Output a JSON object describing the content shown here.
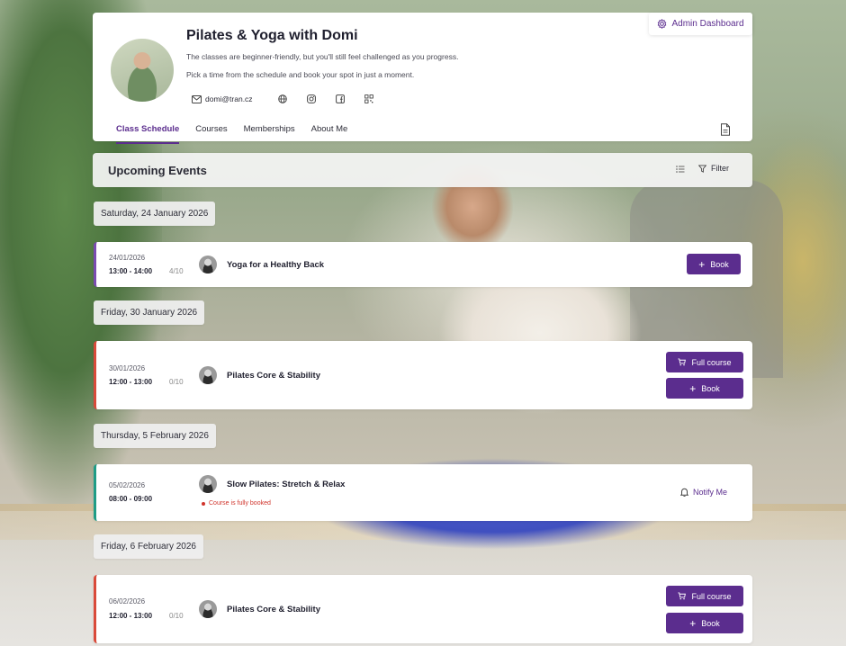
{
  "profile": {
    "title": "Pilates & Yoga with Domi",
    "desc_line1": "The classes are beginner-friendly, but you'll still feel challenged as you progress.",
    "desc_line2": "Pick a time from the schedule and book your spot in just a moment.",
    "email": "domi@tran.cz",
    "contact_icons": [
      "mail-icon",
      "globe-icon",
      "instagram-icon",
      "facebook-icon",
      "qr-icon"
    ]
  },
  "admin": {
    "label": "Admin Dashboard",
    "icon": "gear-icon"
  },
  "tabs": [
    {
      "label": "Class Schedule",
      "active": true
    },
    {
      "label": "Courses",
      "active": false
    },
    {
      "label": "Memberships",
      "active": false
    },
    {
      "label": "About Me",
      "active": false
    }
  ],
  "events_bar": {
    "title": "Upcoming Events",
    "filter_label": "Filter"
  },
  "days": [
    {
      "date_label": "Saturday, 24 January 2026",
      "event": {
        "date": "24/01/2026",
        "time": "13:00 - 14:00",
        "spots": "4/10",
        "title": "Yoga for a Healthy Back",
        "buttons": [
          "Book"
        ]
      }
    },
    {
      "date_label": "Friday, 30 January 2026",
      "event": {
        "date": "30/01/2026",
        "time": "12:00 - 13:00",
        "spots": "0/10",
        "title": "Pilates Core & Stability",
        "buttons": [
          "Full course",
          "Book"
        ]
      }
    },
    {
      "date_label": "Thursday, 5 February 2026",
      "event": {
        "date": "05/02/2026",
        "time": "08:00 - 09:00",
        "title": "Slow Pilates: Stretch & Relax",
        "note": "Course is fully booked",
        "notify_label": "Notify Me"
      }
    },
    {
      "date_label": "Friday, 6 February 2026",
      "event": {
        "date": "06/02/2026",
        "time": "12:00 - 13:00",
        "spots": "0/10",
        "title": "Pilates Core & Stability",
        "buttons": [
          "Full course",
          "Book"
        ]
      }
    }
  ],
  "colors": {
    "accent": "#5b2d8e",
    "ongoing_border": "#7a4bb0",
    "full_border": "#d94a3a",
    "notify_border": "#1f9c86",
    "note_red": "#d0342c"
  }
}
